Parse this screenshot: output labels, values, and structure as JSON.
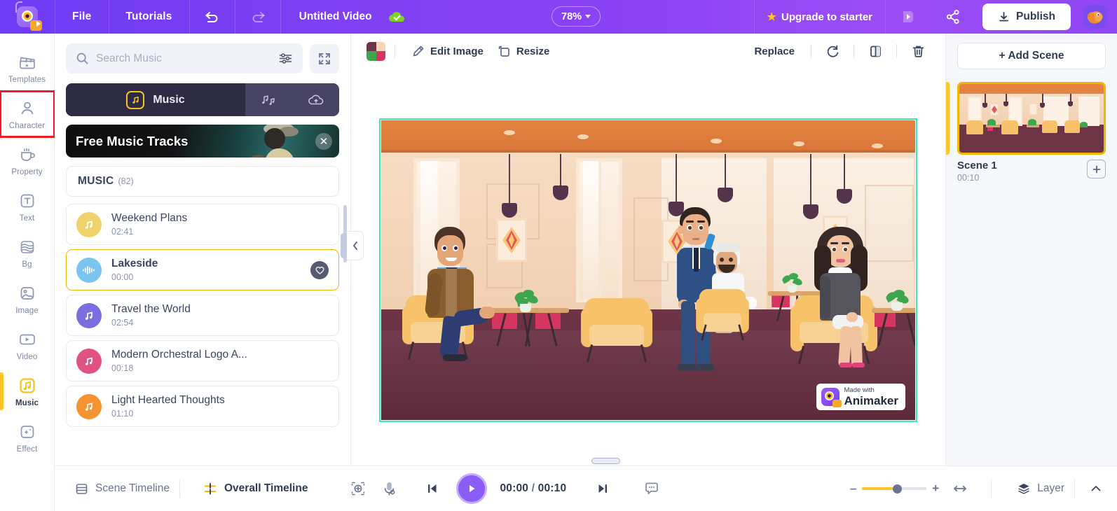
{
  "topbar": {
    "logo_icon": "animaker-logo-icon",
    "menus": [
      {
        "label": "File",
        "name": "file-menu"
      },
      {
        "label": "Tutorials",
        "name": "tutorials-menu"
      }
    ],
    "undo_icon": "undo-icon",
    "redo_icon": "redo-icon",
    "doc_title": "Untitled Video",
    "cloud_icon": "cloud-saved-icon",
    "zoom_level": "78%",
    "upgrade_label": "Upgrade to starter",
    "upgrade_star_icon": "star-icon",
    "preview_icon": "preview-play-icon",
    "share_icon": "share-icon",
    "publish_label": "Publish",
    "publish_icon": "download-icon",
    "avatar_icon": "user-avatar-icon"
  },
  "rail": {
    "items": [
      {
        "label": "Templates",
        "icon": "templates-clapperboard-icon",
        "active": false,
        "highlighted": false
      },
      {
        "label": "Character",
        "icon": "character-person-icon",
        "active": false,
        "highlighted": true
      },
      {
        "label": "Property",
        "icon": "property-cup-icon",
        "active": false,
        "highlighted": false
      },
      {
        "label": "Text",
        "icon": "text-t-icon",
        "active": false,
        "highlighted": false
      },
      {
        "label": "Bg",
        "icon": "background-layers-icon",
        "active": false,
        "highlighted": false
      },
      {
        "label": "Image",
        "icon": "image-picture-icon",
        "active": false,
        "highlighted": false
      },
      {
        "label": "Video",
        "icon": "video-play-icon",
        "active": false,
        "highlighted": false
      },
      {
        "label": "Music",
        "icon": "music-note-icon",
        "active": true,
        "highlighted": false
      },
      {
        "label": "Effect",
        "icon": "effect-sparkle-icon",
        "active": false,
        "highlighted": false
      }
    ]
  },
  "panel": {
    "search_placeholder": "Search Music",
    "search_value": "",
    "search_icon": "search-icon",
    "filter_icon": "filter-sliders-icon",
    "expand_icon": "expand-fullscreen-icon",
    "tab_music_label": "Music",
    "tab_music_icon": "music-note-icon",
    "tab_sfx_icon": "sound-effects-icon",
    "tab_upload_icon": "cloud-upload-icon",
    "promo_title": "Free Music Tracks",
    "promo_close_icon": "close-icon",
    "section_title": "MUSIC",
    "section_count": "(82)",
    "tracks": [
      {
        "name": "Weekend Plans",
        "time": "02:41",
        "color": "#efd26a",
        "selected": false,
        "icon": "music-note-icon"
      },
      {
        "name": "Lakeside",
        "time": "00:00",
        "color": "#79c5ef",
        "selected": true,
        "icon": "waveform-icon",
        "favorite_icon": "heart-icon"
      },
      {
        "name": "Travel the World",
        "time": "02:54",
        "color": "#7c6de0",
        "selected": false,
        "icon": "music-note-icon"
      },
      {
        "name": "Modern Orchestral Logo A...",
        "time": "00:18",
        "color": "#e0527f",
        "selected": false,
        "icon": "music-note-icon"
      },
      {
        "name": "Light Hearted Thoughts",
        "time": "01:10",
        "color": "#f59331",
        "selected": false,
        "icon": "music-note-icon"
      }
    ],
    "collapse_icon": "chevron-left-icon"
  },
  "canvas_toolbar": {
    "swatch_icon": "color-swatch-icon",
    "edit_image_label": "Edit Image",
    "edit_image_icon": "brush-icon",
    "resize_label": "Resize",
    "resize_icon": "resize-icon",
    "replace_label": "Replace",
    "rotate_icon": "rotate-icon",
    "flip_icon": "flip-icon",
    "delete_icon": "trash-icon"
  },
  "stage": {
    "watermark_line1": "Made with",
    "watermark_line2": "Animaker",
    "watermark_icon": "animaker-logo-icon"
  },
  "scenes": {
    "add_scene_label": "+ Add Scene",
    "items": [
      {
        "name": "Scene 1",
        "duration": "00:10",
        "add_icon": "plus-icon"
      }
    ]
  },
  "bottom": {
    "scene_timeline_label": "Scene Timeline",
    "scene_timeline_icon": "scene-timeline-icon",
    "overall_timeline_label": "Overall Timeline",
    "overall_timeline_icon": "overall-timeline-icon",
    "focus_icon": "focus-target-icon",
    "mic_icon": "microphone-icon",
    "prev_frame_icon": "previous-frame-icon",
    "play_icon": "play-icon",
    "current_time": "00:00",
    "time_separator": " / ",
    "total_time": "00:10",
    "next_frame_icon": "next-frame-icon",
    "caption_icon": "caption-bubble-icon",
    "zoom_minus": "–",
    "zoom_plus": "+",
    "fit_icon": "fit-width-icon",
    "layer_label": "Layer",
    "layer_icon": "layers-icon",
    "expand_icon": "chevron-up-icon"
  },
  "colors": {
    "brand_purple": "#7b3ff2",
    "accent_yellow": "#ffc629",
    "selection_green": "#3ee8b5",
    "highlight_red": "#ee1c25"
  }
}
